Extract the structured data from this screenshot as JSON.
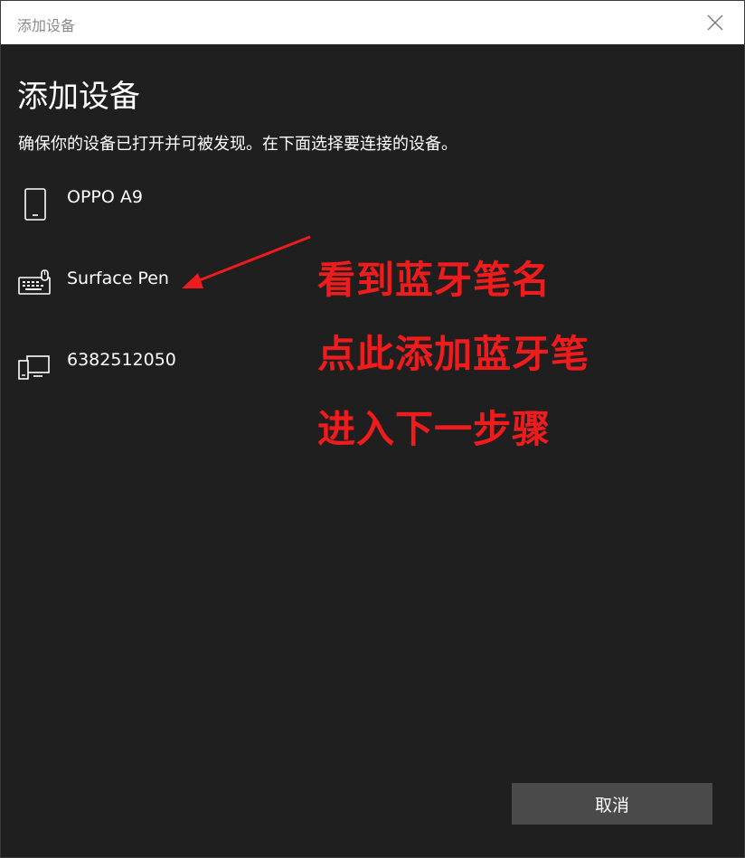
{
  "window": {
    "title": "添加设备"
  },
  "page": {
    "heading": "添加设备",
    "subtitle": "确保你的设备已打开并可被发现。在下面选择要连接的设备。"
  },
  "devices": [
    {
      "name": "OPPO A9",
      "icon": "phone-icon"
    },
    {
      "name": "Surface Pen",
      "icon": "keyboard-pen-icon"
    },
    {
      "name": "6382512050",
      "icon": "display-device-icon"
    }
  ],
  "annotation": {
    "color": "#ee1c1c",
    "lines": [
      "看到蓝牙笔名",
      "点此添加蓝牙笔",
      "进入下一步骤"
    ]
  },
  "footer": {
    "cancel_label": "取消"
  }
}
